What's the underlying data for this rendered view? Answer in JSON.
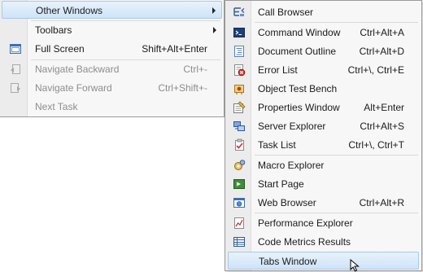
{
  "parent_menu": {
    "items": [
      {
        "label": "Other Windows",
        "shortcut": "",
        "submenu": true,
        "highlighted": true
      },
      {
        "label": "Toolbars",
        "shortcut": "",
        "submenu": true
      },
      {
        "label": "Full Screen",
        "shortcut": "Shift+Alt+Enter"
      },
      {
        "label": "Navigate Backward",
        "shortcut": "Ctrl+-",
        "disabled": true
      },
      {
        "label": "Navigate Forward",
        "shortcut": "Ctrl+Shift+-",
        "disabled": true
      },
      {
        "label": "Next Task",
        "shortcut": "",
        "disabled": true
      }
    ]
  },
  "submenu": {
    "items": [
      {
        "label": "Call Browser",
        "shortcut": "",
        "icon": "call-browser-icon"
      },
      {
        "label": "Command Window",
        "shortcut": "Ctrl+Alt+A",
        "icon": "command-window-icon"
      },
      {
        "label": "Document Outline",
        "shortcut": "Ctrl+Alt+D",
        "icon": "document-outline-icon"
      },
      {
        "label": "Error List",
        "shortcut": "Ctrl+\\, Ctrl+E",
        "icon": "error-list-icon"
      },
      {
        "label": "Object Test Bench",
        "shortcut": "",
        "icon": "object-test-bench-icon"
      },
      {
        "label": "Properties Window",
        "shortcut": "Alt+Enter",
        "icon": "properties-window-icon"
      },
      {
        "label": "Server Explorer",
        "shortcut": "Ctrl+Alt+S",
        "icon": "server-explorer-icon"
      },
      {
        "label": "Task List",
        "shortcut": "Ctrl+\\, Ctrl+T",
        "icon": "task-list-icon"
      },
      {
        "label": "Macro Explorer",
        "shortcut": "",
        "icon": "macro-explorer-icon"
      },
      {
        "label": "Start Page",
        "shortcut": "",
        "icon": "start-page-icon"
      },
      {
        "label": "Web Browser",
        "shortcut": "Ctrl+Alt+R",
        "icon": "web-browser-icon"
      },
      {
        "label": "Performance Explorer",
        "shortcut": "",
        "icon": "performance-explorer-icon"
      },
      {
        "label": "Code Metrics Results",
        "shortcut": "",
        "icon": "code-metrics-icon"
      },
      {
        "label": "Tabs Window",
        "shortcut": "",
        "icon": "",
        "highlighted": true
      }
    ]
  },
  "colors": {
    "highlight_top": "#e8f2fc",
    "highlight_bottom": "#cfe3f8",
    "highlight_border": "#a8c9ec",
    "disabled_text": "#8d8d8d"
  }
}
